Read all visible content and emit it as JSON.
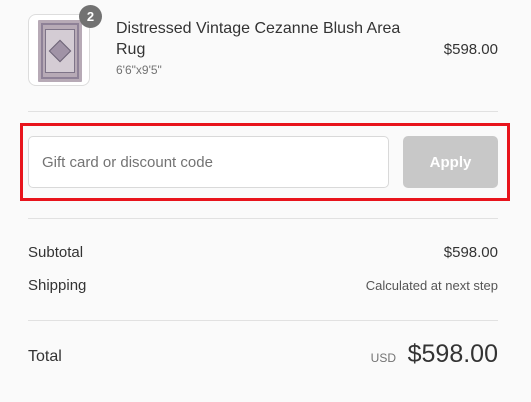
{
  "cart_item": {
    "quantity": "2",
    "name": "Distressed Vintage Cezanne Blush Area Rug",
    "variant": "6'6\"x9'5\"",
    "price": "$598.00"
  },
  "discount": {
    "placeholder": "Gift card or discount code",
    "value": "",
    "apply_label": "Apply"
  },
  "summary": {
    "subtotal_label": "Subtotal",
    "subtotal_value": "$598.00",
    "shipping_label": "Shipping",
    "shipping_value": "Calculated at next step",
    "total_label": "Total",
    "currency": "USD",
    "total_value": "$598.00"
  },
  "colors": {
    "highlight": "#e8141c",
    "apply_button_disabled": "#c8c8c8",
    "badge": "#727272"
  }
}
